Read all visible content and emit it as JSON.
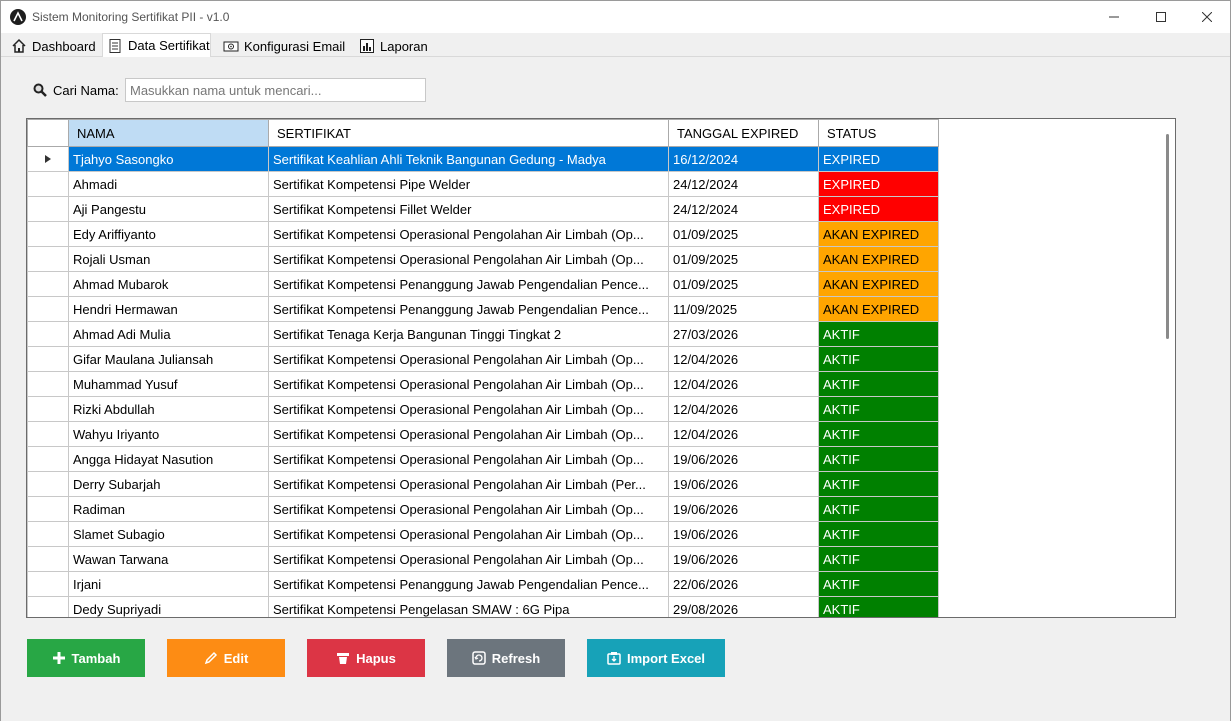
{
  "window": {
    "title": "Sistem Monitoring Sertifikat PII - v1.0"
  },
  "tabs": [
    {
      "label": "Dashboard",
      "icon": "home-icon"
    },
    {
      "label": "Data Sertifikat",
      "icon": "document-icon"
    },
    {
      "label": "Konfigurasi Email",
      "icon": "email-config-icon"
    },
    {
      "label": "Laporan",
      "icon": "bar-chart-icon"
    }
  ],
  "search": {
    "label": "Cari Nama:",
    "placeholder": "Masukkan nama untuk mencari..."
  },
  "table": {
    "headers": [
      "NAMA",
      "SERTIFIKAT",
      "TANGGAL EXPIRED",
      "STATUS"
    ],
    "rows": [
      {
        "nama": "Tjahyo Sasongko",
        "sertifikat": "Sertifikat Keahlian Ahli Teknik Bangunan Gedung - Madya",
        "tanggal": "16/12/2024",
        "status": "EXPIRED"
      },
      {
        "nama": "Ahmadi",
        "sertifikat": "Sertifikat Kompetensi Pipe Welder",
        "tanggal": "24/12/2024",
        "status": "EXPIRED"
      },
      {
        "nama": "Aji Pangestu",
        "sertifikat": "Sertifikat Kompetensi Fillet Welder",
        "tanggal": "24/12/2024",
        "status": "EXPIRED"
      },
      {
        "nama": "Edy Ariffiyanto",
        "sertifikat": "Sertifikat Kompetensi Operasional Pengolahan Air Limbah (Op...",
        "tanggal": "01/09/2025",
        "status": "AKAN EXPIRED"
      },
      {
        "nama": "Rojali Usman",
        "sertifikat": "Sertifikat Kompetensi Operasional Pengolahan Air Limbah (Op...",
        "tanggal": "01/09/2025",
        "status": "AKAN EXPIRED"
      },
      {
        "nama": "Ahmad Mubarok",
        "sertifikat": "Sertifikat Kompetensi Penanggung Jawab Pengendalian Pence...",
        "tanggal": "01/09/2025",
        "status": "AKAN EXPIRED"
      },
      {
        "nama": "Hendri Hermawan",
        "sertifikat": "Sertifikat Kompetensi Penanggung Jawab Pengendalian Pence...",
        "tanggal": "11/09/2025",
        "status": "AKAN EXPIRED"
      },
      {
        "nama": "Ahmad Adi Mulia",
        "sertifikat": "Sertifikat Tenaga Kerja Bangunan Tinggi Tingkat 2",
        "tanggal": "27/03/2026",
        "status": "AKTIF"
      },
      {
        "nama": "Gifar Maulana Juliansah",
        "sertifikat": "Sertifikat Kompetensi Operasional Pengolahan Air Limbah (Op...",
        "tanggal": "12/04/2026",
        "status": "AKTIF"
      },
      {
        "nama": "Muhammad Yusuf",
        "sertifikat": "Sertifikat Kompetensi Operasional Pengolahan Air Limbah (Op...",
        "tanggal": "12/04/2026",
        "status": "AKTIF"
      },
      {
        "nama": "Rizki Abdullah",
        "sertifikat": "Sertifikat Kompetensi Operasional Pengolahan Air Limbah (Op...",
        "tanggal": "12/04/2026",
        "status": "AKTIF"
      },
      {
        "nama": "Wahyu Iriyanto",
        "sertifikat": "Sertifikat Kompetensi Operasional Pengolahan Air Limbah (Op...",
        "tanggal": "12/04/2026",
        "status": "AKTIF"
      },
      {
        "nama": "Angga Hidayat Nasution",
        "sertifikat": "Sertifikat Kompetensi Operasional Pengolahan Air Limbah (Op...",
        "tanggal": "19/06/2026",
        "status": "AKTIF"
      },
      {
        "nama": "Derry Subarjah",
        "sertifikat": "Sertifikat Kompetensi Operasional Pengolahan Air Limbah (Per...",
        "tanggal": "19/06/2026",
        "status": "AKTIF"
      },
      {
        "nama": "Radiman",
        "sertifikat": "Sertifikat Kompetensi Operasional Pengolahan Air Limbah (Op...",
        "tanggal": "19/06/2026",
        "status": "AKTIF"
      },
      {
        "nama": "Slamet Subagio",
        "sertifikat": "Sertifikat Kompetensi Operasional Pengolahan Air Limbah (Op...",
        "tanggal": "19/06/2026",
        "status": "AKTIF"
      },
      {
        "nama": "Wawan Tarwana",
        "sertifikat": "Sertifikat Kompetensi Operasional Pengolahan Air Limbah (Op...",
        "tanggal": "19/06/2026",
        "status": "AKTIF"
      },
      {
        "nama": "Irjani",
        "sertifikat": "Sertifikat Kompetensi Penanggung Jawab Pengendalian Pence...",
        "tanggal": "22/06/2026",
        "status": "AKTIF"
      },
      {
        "nama": "Dedy Supriyadi",
        "sertifikat": "Sertifikat Kompetensi Pengelasan SMAW : 6G Pipa",
        "tanggal": "29/08/2026",
        "status": "AKTIF"
      }
    ],
    "selected_row": 0,
    "status_colors": {
      "EXPIRED": "#ff0000",
      "AKAN EXPIRED": "#ffa500",
      "AKTIF": "#008000"
    },
    "selection_color": "#0078d7"
  },
  "buttons": {
    "tambah": {
      "label": "Tambah",
      "color": "#28a745",
      "icon": "plus-icon"
    },
    "edit": {
      "label": "Edit",
      "color": "#fd8c14",
      "icon": "pencil-icon"
    },
    "hapus": {
      "label": "Hapus",
      "color": "#dc3545",
      "icon": "trash-icon"
    },
    "refresh": {
      "label": "Refresh",
      "color": "#6c757d",
      "icon": "refresh-icon"
    },
    "import": {
      "label": "Import Excel",
      "color": "#17a2b8",
      "icon": "excel-import-icon"
    }
  }
}
